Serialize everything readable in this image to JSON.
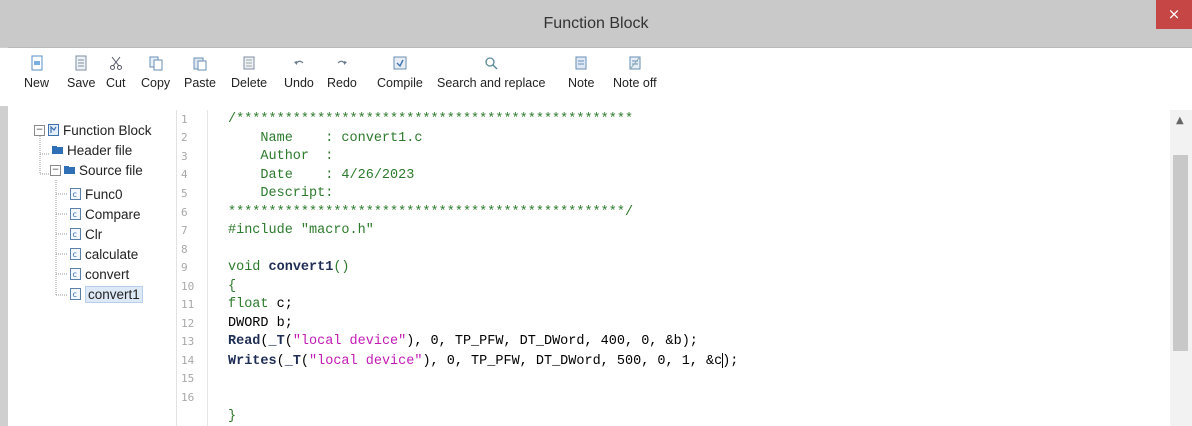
{
  "window": {
    "title": "Function Block",
    "close_label": "×"
  },
  "toolbar": {
    "new": "New",
    "save": "Save",
    "cut": "Cut",
    "copy": "Copy",
    "paste": "Paste",
    "delete": "Delete",
    "undo": "Undo",
    "redo": "Redo",
    "compile": "Compile",
    "search_replace": "Search and replace",
    "note": "Note",
    "note_off": "Note off"
  },
  "tree": {
    "root": "Function Block",
    "header_file": "Header file",
    "source_file": "Source file",
    "items": [
      "Func0",
      "Compare",
      "Clr",
      "calculate",
      "convert",
      "convert1"
    ],
    "selected": "convert1",
    "expander_minus": "−"
  },
  "editor": {
    "line_numbers": [
      "1",
      "2",
      "3",
      "4",
      "5",
      "6",
      "7",
      "8",
      "9",
      "10",
      "11",
      "12",
      "13",
      "14",
      "15",
      "16"
    ],
    "l1": "/*************************************************",
    "l2_key": "    Name    ",
    "l2_val": ": convert1.c",
    "l3_key": "    Author  ",
    "l3_val": ":",
    "l4_key": "    Date    ",
    "l4_val": ": 4/26/2023",
    "l5": "    Descript:",
    "l6": "*************************************************/",
    "l7_a": "#include ",
    "l7_b": "\"macro.h\"",
    "l9_a": "void ",
    "l9_b": "convert1",
    "l9_c": "()",
    "l10": "{",
    "l11_a": "float",
    "l11_b": " c;",
    "l12": "DWORD b;",
    "l13_a": "Read",
    "l13_b": "(",
    "l13_c": "_T",
    "l13_d": "(",
    "l13_e": "\"local device\"",
    "l13_f": "), 0, TP_PFW, DT_DWord, 400, 0, &b);",
    "l14_a": "Writes",
    "l14_b": "(",
    "l14_c": "_T",
    "l14_d": "(",
    "l14_e": "\"local device\"",
    "l14_f": "), 0, TP_PFW, DT_DWord, 500, 0, 1, &c",
    "l14_g": ");",
    "l16": "}"
  },
  "scrollbar": {
    "up_arrow": "▲"
  },
  "colors": {
    "keyword": "#2c7a2c",
    "string": "#c21bb5",
    "function": "#1f2d55",
    "selected_bg": "#dde9f7"
  }
}
